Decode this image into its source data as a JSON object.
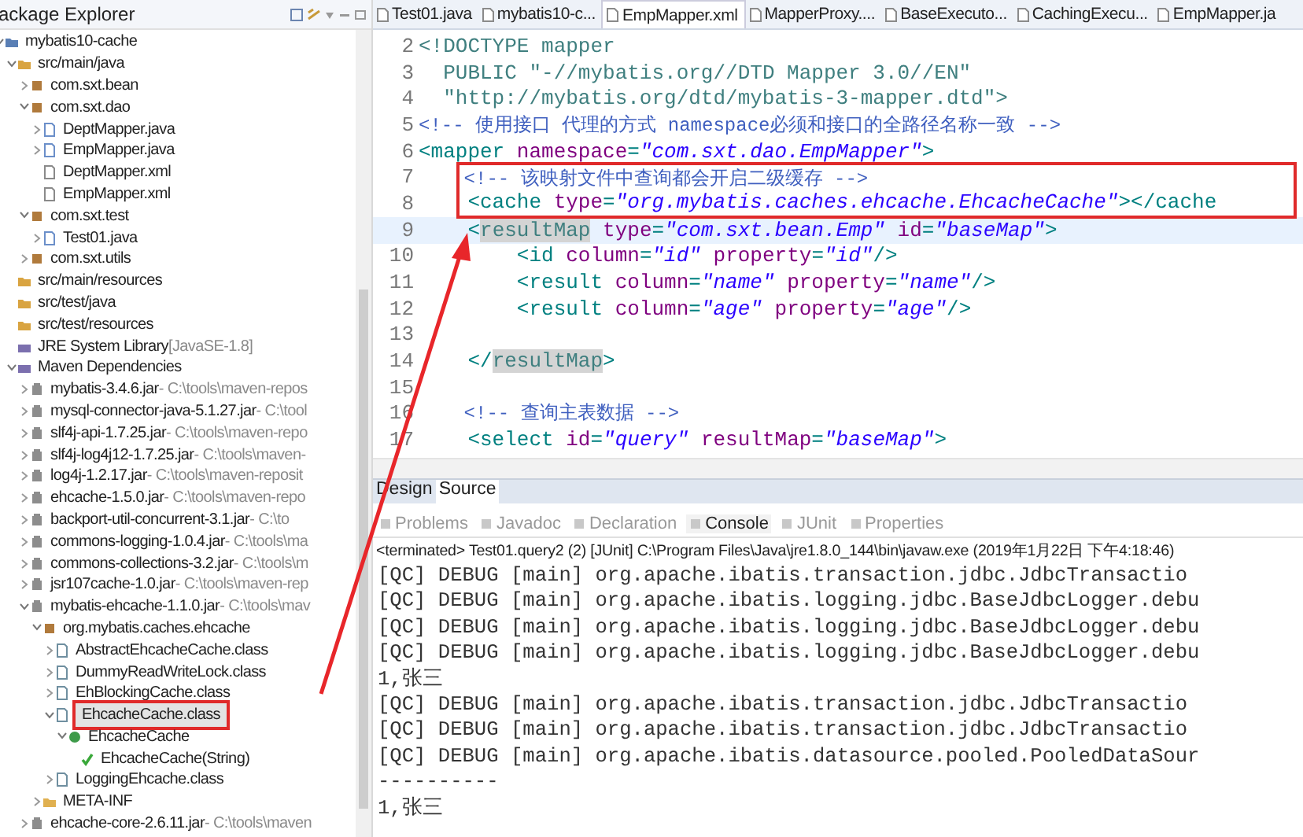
{
  "explorer": {
    "title": "ackage Explorer",
    "tree": [
      {
        "label": "mybatis10-cache",
        "kind": "project",
        "expanded": true,
        "selected": false,
        "children": [
          {
            "label": "src/main/java",
            "kind": "srcfolder",
            "expanded": true,
            "selected": false,
            "children": [
              {
                "label": "com.sxt.bean",
                "kind": "package",
                "expanded": false,
                "selected": false
              },
              {
                "label": "com.sxt.dao",
                "kind": "package",
                "expanded": true,
                "selected": false,
                "children": [
                  {
                    "label": "DeptMapper.java",
                    "kind": "java",
                    "expanded": false,
                    "selected": false
                  },
                  {
                    "label": "EmpMapper.java",
                    "kind": "java",
                    "expanded": false,
                    "selected": false
                  },
                  {
                    "label": "DeptMapper.xml",
                    "kind": "xml",
                    "selected": false
                  },
                  {
                    "label": "EmpMapper.xml",
                    "kind": "xml",
                    "selected": false
                  }
                ]
              },
              {
                "label": "com.sxt.test",
                "kind": "package",
                "expanded": true,
                "selected": false,
                "children": [
                  {
                    "label": "Test01.java",
                    "kind": "java",
                    "expanded": false,
                    "selected": false
                  }
                ]
              },
              {
                "label": "com.sxt.utils",
                "kind": "package",
                "expanded": false,
                "selected": false
              }
            ]
          },
          {
            "label": "src/main/resources",
            "kind": "srcfolder",
            "selected": false
          },
          {
            "label": "src/test/java",
            "kind": "srcfolder",
            "selected": false
          },
          {
            "label": "src/test/resources",
            "kind": "srcfolder",
            "selected": false
          },
          {
            "label": "JRE System Library",
            "detail": "[JavaSE-1.8]",
            "kind": "library",
            "selected": false
          },
          {
            "label": "Maven Dependencies",
            "kind": "library",
            "expanded": true,
            "selected": false,
            "children": [
              {
                "label": "mybatis-3.4.6.jar",
                "detail": "- C:\\tools\\maven-repos",
                "kind": "jar",
                "expanded": false,
                "selected": false
              },
              {
                "label": "mysql-connector-java-5.1.27.jar",
                "detail": "- C:\\tool",
                "kind": "jar",
                "expanded": false,
                "selected": false
              },
              {
                "label": "slf4j-api-1.7.25.jar",
                "detail": "- C:\\tools\\maven-repo",
                "kind": "jar",
                "expanded": false,
                "selected": false
              },
              {
                "label": "slf4j-log4j12-1.7.25.jar",
                "detail": "- C:\\tools\\maven-",
                "kind": "jar",
                "expanded": false,
                "selected": false
              },
              {
                "label": "log4j-1.2.17.jar",
                "detail": "- C:\\tools\\maven-reposit",
                "kind": "jar",
                "expanded": false,
                "selected": false
              },
              {
                "label": "ehcache-1.5.0.jar",
                "detail": "- C:\\tools\\maven-repo",
                "kind": "jar",
                "expanded": false,
                "selected": false
              },
              {
                "label": "backport-util-concurrent-3.1.jar",
                "detail": "- C:\\to",
                "kind": "jar",
                "expanded": false,
                "selected": false
              },
              {
                "label": "commons-logging-1.0.4.jar",
                "detail": "- C:\\tools\\ma",
                "kind": "jar",
                "expanded": false,
                "selected": false
              },
              {
                "label": "commons-collections-3.2.jar",
                "detail": "- C:\\tools\\m",
                "kind": "jar",
                "expanded": false,
                "selected": false
              },
              {
                "label": "jsr107cache-1.0.jar",
                "detail": "- C:\\tools\\maven-rep",
                "kind": "jar",
                "expanded": false,
                "selected": false
              },
              {
                "label": "mybatis-ehcache-1.1.0.jar",
                "detail": "- C:\\tools\\mav",
                "kind": "jar",
                "expanded": true,
                "selected": false,
                "children": [
                  {
                    "label": "org.mybatis.caches.ehcache",
                    "kind": "package",
                    "expanded": true,
                    "selected": false,
                    "children": [
                      {
                        "label": "AbstractEhcacheCache.class",
                        "kind": "classfile",
                        "expanded": false,
                        "selected": false
                      },
                      {
                        "label": "DummyReadWriteLock.class",
                        "kind": "classfile",
                        "expanded": false,
                        "selected": false
                      },
                      {
                        "label": "EhBlockingCache.class",
                        "kind": "classfile",
                        "expanded": false,
                        "selected": false
                      },
                      {
                        "label": "EhcacheCache.class",
                        "kind": "classfile",
                        "expanded": true,
                        "selected": true,
                        "boxed": true,
                        "children": [
                          {
                            "label": "EhcacheCache",
                            "kind": "class",
                            "expanded": true,
                            "selected": false,
                            "children": [
                              {
                                "label": "EhcacheCache(String)",
                                "kind": "method",
                                "selected": false
                              }
                            ]
                          }
                        ]
                      },
                      {
                        "label": "LoggingEhcache.class",
                        "kind": "classfile",
                        "expanded": false,
                        "selected": false
                      }
                    ]
                  },
                  {
                    "label": "META-INF",
                    "kind": "folder",
                    "expanded": false,
                    "selected": false
                  }
                ]
              },
              {
                "label": "ehcache-core-2.6.11.jar",
                "detail": "- C:\\tools\\maven",
                "kind": "jar",
                "expanded": false,
                "selected": false
              }
            ]
          }
        ]
      }
    ]
  },
  "editor": {
    "tabs": [
      {
        "label": "Test01.java",
        "selected": false
      },
      {
        "label": "mybatis10-c...",
        "selected": false
      },
      {
        "label": "EmpMapper.xml",
        "selected": true
      },
      {
        "label": "MapperProxy....",
        "selected": false
      },
      {
        "label": "BaseExecuto...",
        "selected": false
      },
      {
        "label": "CachingExecu...",
        "selected": false
      },
      {
        "label": "EmpMapper.ja",
        "selected": false
      }
    ],
    "lines": [
      {
        "number": "2",
        "current": false,
        "boxed": false,
        "tokens": [
          {
            "kind": "doctype",
            "text": "<!DOCTYPE mapper"
          }
        ]
      },
      {
        "number": "3",
        "current": false,
        "boxed": false,
        "tokens": [
          {
            "kind": "doctype",
            "text": "  PUBLIC "
          },
          {
            "kind": "dstring",
            "text": "\"-//mybatis.org//DTD Mapper 3.0//EN\""
          }
        ]
      },
      {
        "number": "4",
        "current": false,
        "boxed": false,
        "tokens": [
          {
            "kind": "dstring",
            "text": "  \"http://mybatis.org/dtd/mybatis-3-mapper.dtd\""
          },
          {
            "kind": "doctype",
            "text": ">"
          }
        ]
      },
      {
        "number": "5",
        "current": false,
        "boxed": false,
        "tokens": [
          {
            "kind": "comment",
            "text": "<!-- 使用接口 代理的方式 namespace必须和接口的全路径名称一致 -->"
          }
        ]
      },
      {
        "number": "6",
        "current": false,
        "boxed": false,
        "tokens": [
          {
            "kind": "tag",
            "text": "<mapper "
          },
          {
            "kind": "attr",
            "text": "namespace"
          },
          {
            "kind": "tag",
            "text": "="
          },
          {
            "kind": "value",
            "text": "\"com.sxt.dao.EmpMapper\""
          },
          {
            "kind": "tag",
            "text": ">"
          }
        ]
      },
      {
        "number": "7",
        "current": false,
        "boxed": true,
        "tokens": [
          {
            "kind": "comment",
            "text": "    <!-- 该映射文件中查询都会开启二级缓存 -->"
          }
        ]
      },
      {
        "number": "8",
        "current": false,
        "boxed": true,
        "tokens": [
          {
            "kind": "tag",
            "text": "    <cache "
          },
          {
            "kind": "attr",
            "text": "type"
          },
          {
            "kind": "tag",
            "text": "="
          },
          {
            "kind": "value",
            "text": "\"org.mybatis.caches.ehcache.EhcacheCache\""
          },
          {
            "kind": "tag",
            "text": "></cache"
          }
        ]
      },
      {
        "number": "9",
        "current": true,
        "boxed": false,
        "tokens": [
          {
            "kind": "tag",
            "text": "    <"
          },
          {
            "kind": "marked",
            "text": "resultMap"
          },
          {
            "kind": "attr",
            "text": " type"
          },
          {
            "kind": "tag",
            "text": "="
          },
          {
            "kind": "value",
            "text": "\"com.sxt.bean.Emp\""
          },
          {
            "kind": "attr",
            "text": " id"
          },
          {
            "kind": "tag",
            "text": "="
          },
          {
            "kind": "value",
            "text": "\"baseMap\""
          },
          {
            "kind": "tag",
            "text": ">"
          }
        ]
      },
      {
        "number": "10",
        "current": false,
        "boxed": false,
        "tokens": [
          {
            "kind": "tag",
            "text": "        <id "
          },
          {
            "kind": "attr",
            "text": "column"
          },
          {
            "kind": "tag",
            "text": "="
          },
          {
            "kind": "value",
            "text": "\"id\""
          },
          {
            "kind": "attr",
            "text": " property"
          },
          {
            "kind": "tag",
            "text": "="
          },
          {
            "kind": "value",
            "text": "\"id\""
          },
          {
            "kind": "tag",
            "text": "/>"
          }
        ]
      },
      {
        "number": "11",
        "current": false,
        "boxed": false,
        "tokens": [
          {
            "kind": "tag",
            "text": "        <result "
          },
          {
            "kind": "attr",
            "text": "column"
          },
          {
            "kind": "tag",
            "text": "="
          },
          {
            "kind": "value",
            "text": "\"name\""
          },
          {
            "kind": "attr",
            "text": " property"
          },
          {
            "kind": "tag",
            "text": "="
          },
          {
            "kind": "value",
            "text": "\"name\""
          },
          {
            "kind": "tag",
            "text": "/>"
          }
        ]
      },
      {
        "number": "12",
        "current": false,
        "boxed": false,
        "tokens": [
          {
            "kind": "tag",
            "text": "        <result "
          },
          {
            "kind": "attr",
            "text": "column"
          },
          {
            "kind": "tag",
            "text": "="
          },
          {
            "kind": "value",
            "text": "\"age\""
          },
          {
            "kind": "attr",
            "text": " property"
          },
          {
            "kind": "tag",
            "text": "="
          },
          {
            "kind": "value",
            "text": "\"age\""
          },
          {
            "kind": "tag",
            "text": "/>"
          }
        ]
      },
      {
        "number": "13",
        "current": false,
        "boxed": false
      },
      {
        "number": "14",
        "current": false,
        "boxed": false,
        "tokens": [
          {
            "kind": "tag",
            "text": "    </"
          },
          {
            "kind": "marked",
            "text": "resultMap"
          },
          {
            "kind": "tag",
            "text": ">"
          }
        ]
      },
      {
        "number": "15",
        "current": false,
        "boxed": false
      },
      {
        "number": "16",
        "current": false,
        "boxed": false,
        "tokens": [
          {
            "kind": "comment",
            "text": "    <!-- 查询主表数据 -->"
          }
        ]
      },
      {
        "number": "17",
        "current": false,
        "boxed": false,
        "tokens": [
          {
            "kind": "tag",
            "text": "    <select "
          },
          {
            "kind": "attr",
            "text": "id"
          },
          {
            "kind": "tag",
            "text": "="
          },
          {
            "kind": "value",
            "text": "\"query\""
          },
          {
            "kind": "attr",
            "text": " resultMap"
          },
          {
            "kind": "tag",
            "text": "="
          },
          {
            "kind": "value",
            "text": "\"baseMap\""
          },
          {
            "kind": "tag",
            "text": ">"
          }
        ]
      }
    ],
    "mode_tabs": [
      {
        "label": "Design",
        "selected": false
      },
      {
        "label": "Source",
        "selected": true
      }
    ]
  },
  "console": {
    "tabs": [
      {
        "label": "Problems",
        "selected": false
      },
      {
        "label": "Javadoc",
        "selected": false
      },
      {
        "label": "Declaration",
        "selected": false
      },
      {
        "label": "Console",
        "selected": true
      },
      {
        "label": "JUnit",
        "selected": false
      },
      {
        "label": "Properties",
        "selected": false
      }
    ],
    "header": "<terminated> Test01.query2 (2) [JUnit] C:\\Program Files\\Java\\jre1.8.0_144\\bin\\javaw.exe (2019年1月22日 下午4:18:46)",
    "lines": [
      "[QC] DEBUG [main] org.apache.ibatis.transaction.jdbc.JdbcTransactio",
      "[QC] DEBUG [main] org.apache.ibatis.logging.jdbc.BaseJdbcLogger.debu",
      "[QC] DEBUG [main] org.apache.ibatis.logging.jdbc.BaseJdbcLogger.debu",
      "[QC] DEBUG [main] org.apache.ibatis.logging.jdbc.BaseJdbcLogger.debu",
      "1,张三",
      "[QC] DEBUG [main] org.apache.ibatis.transaction.jdbc.JdbcTransactio",
      "[QC] DEBUG [main] org.apache.ibatis.transaction.jdbc.JdbcTransactio",
      "[QC] DEBUG [main] org.apache.ibatis.datasource.pooled.PooledDataSour",
      "----------",
      "1,张三"
    ]
  }
}
